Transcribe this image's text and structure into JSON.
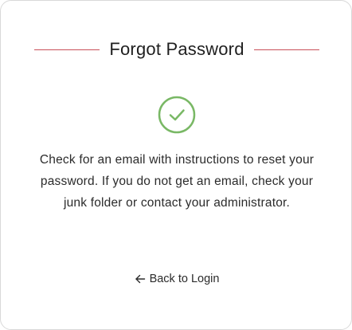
{
  "dialog": {
    "title": "Forgot Password",
    "message": "Check for an email with instructions to reset your password. If you do not get an email, check your junk folder or contact your administrator.",
    "success_icon": "check-circle-icon",
    "back_link": {
      "icon": "arrow-left-icon",
      "label": "Back to Login"
    }
  },
  "colors": {
    "accent_rule": "#c9505a",
    "success": "#79b865",
    "text": "#2b2b2b"
  }
}
